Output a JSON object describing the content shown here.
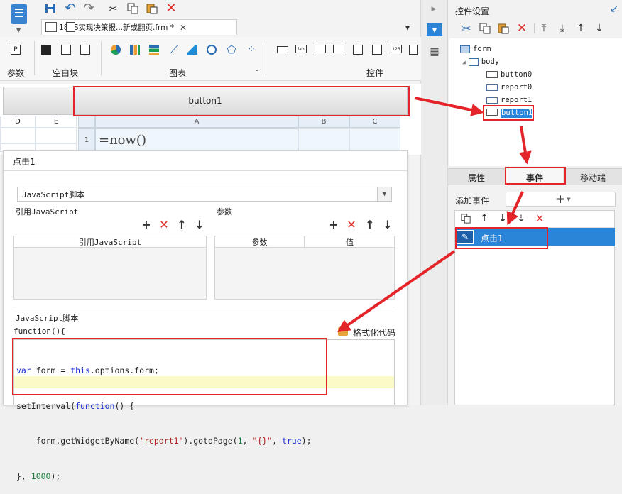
{
  "left": {
    "document_tab": "18-JS实现决策报...新或翻页.frm *",
    "ribbon": {
      "groups": [
        {
          "label": "参数"
        },
        {
          "label": "空白块"
        },
        {
          "label": "图表"
        },
        {
          "label": "控件"
        }
      ],
      "icons": [
        "save-icon",
        "undo-icon",
        "redo-icon",
        "cut-icon",
        "copy-icon",
        "paste-icon",
        "delete-icon"
      ]
    },
    "canvas_button_label": "button1",
    "grid": {
      "left_columns": [
        "D",
        "E"
      ],
      "columns": [
        "A",
        "B",
        "C"
      ],
      "row_number": "1",
      "formula": "=now()"
    },
    "dialog": {
      "title": "点击1",
      "script_type": "JavaScript脚本",
      "ref_js_section_label": "引用JavaScript",
      "ref_js_column": "引用JavaScript",
      "params_section_label": "参数",
      "param_columns": [
        "参数",
        "值"
      ],
      "script_section_label": "JavaScript脚本",
      "function_header": "function(){",
      "format_code_label": "格式化代码",
      "code_lines": [
        "var form = this.options.form;",
        "setInterval(function() {",
        "    form.getWidgetByName('report1').gotoPage(1, \"{}\", true);",
        "}, 1000);"
      ]
    }
  },
  "right": {
    "panel_title": "控件设置",
    "tree": [
      {
        "label": "form"
      },
      {
        "label": "body"
      },
      {
        "label": "button0"
      },
      {
        "label": "report0"
      },
      {
        "label": "report1"
      },
      {
        "label": "button1",
        "selected": true
      }
    ],
    "tabs": [
      "属性",
      "事件",
      "移动端"
    ],
    "active_tab": "事件",
    "add_event_label": "添加事件",
    "events": [
      {
        "label": "点击1",
        "selected": true
      }
    ]
  },
  "colors": {
    "highlight_red": "#e3252a",
    "selection_blue": "#2a84d8",
    "accent_blue": "#2a6db5"
  }
}
